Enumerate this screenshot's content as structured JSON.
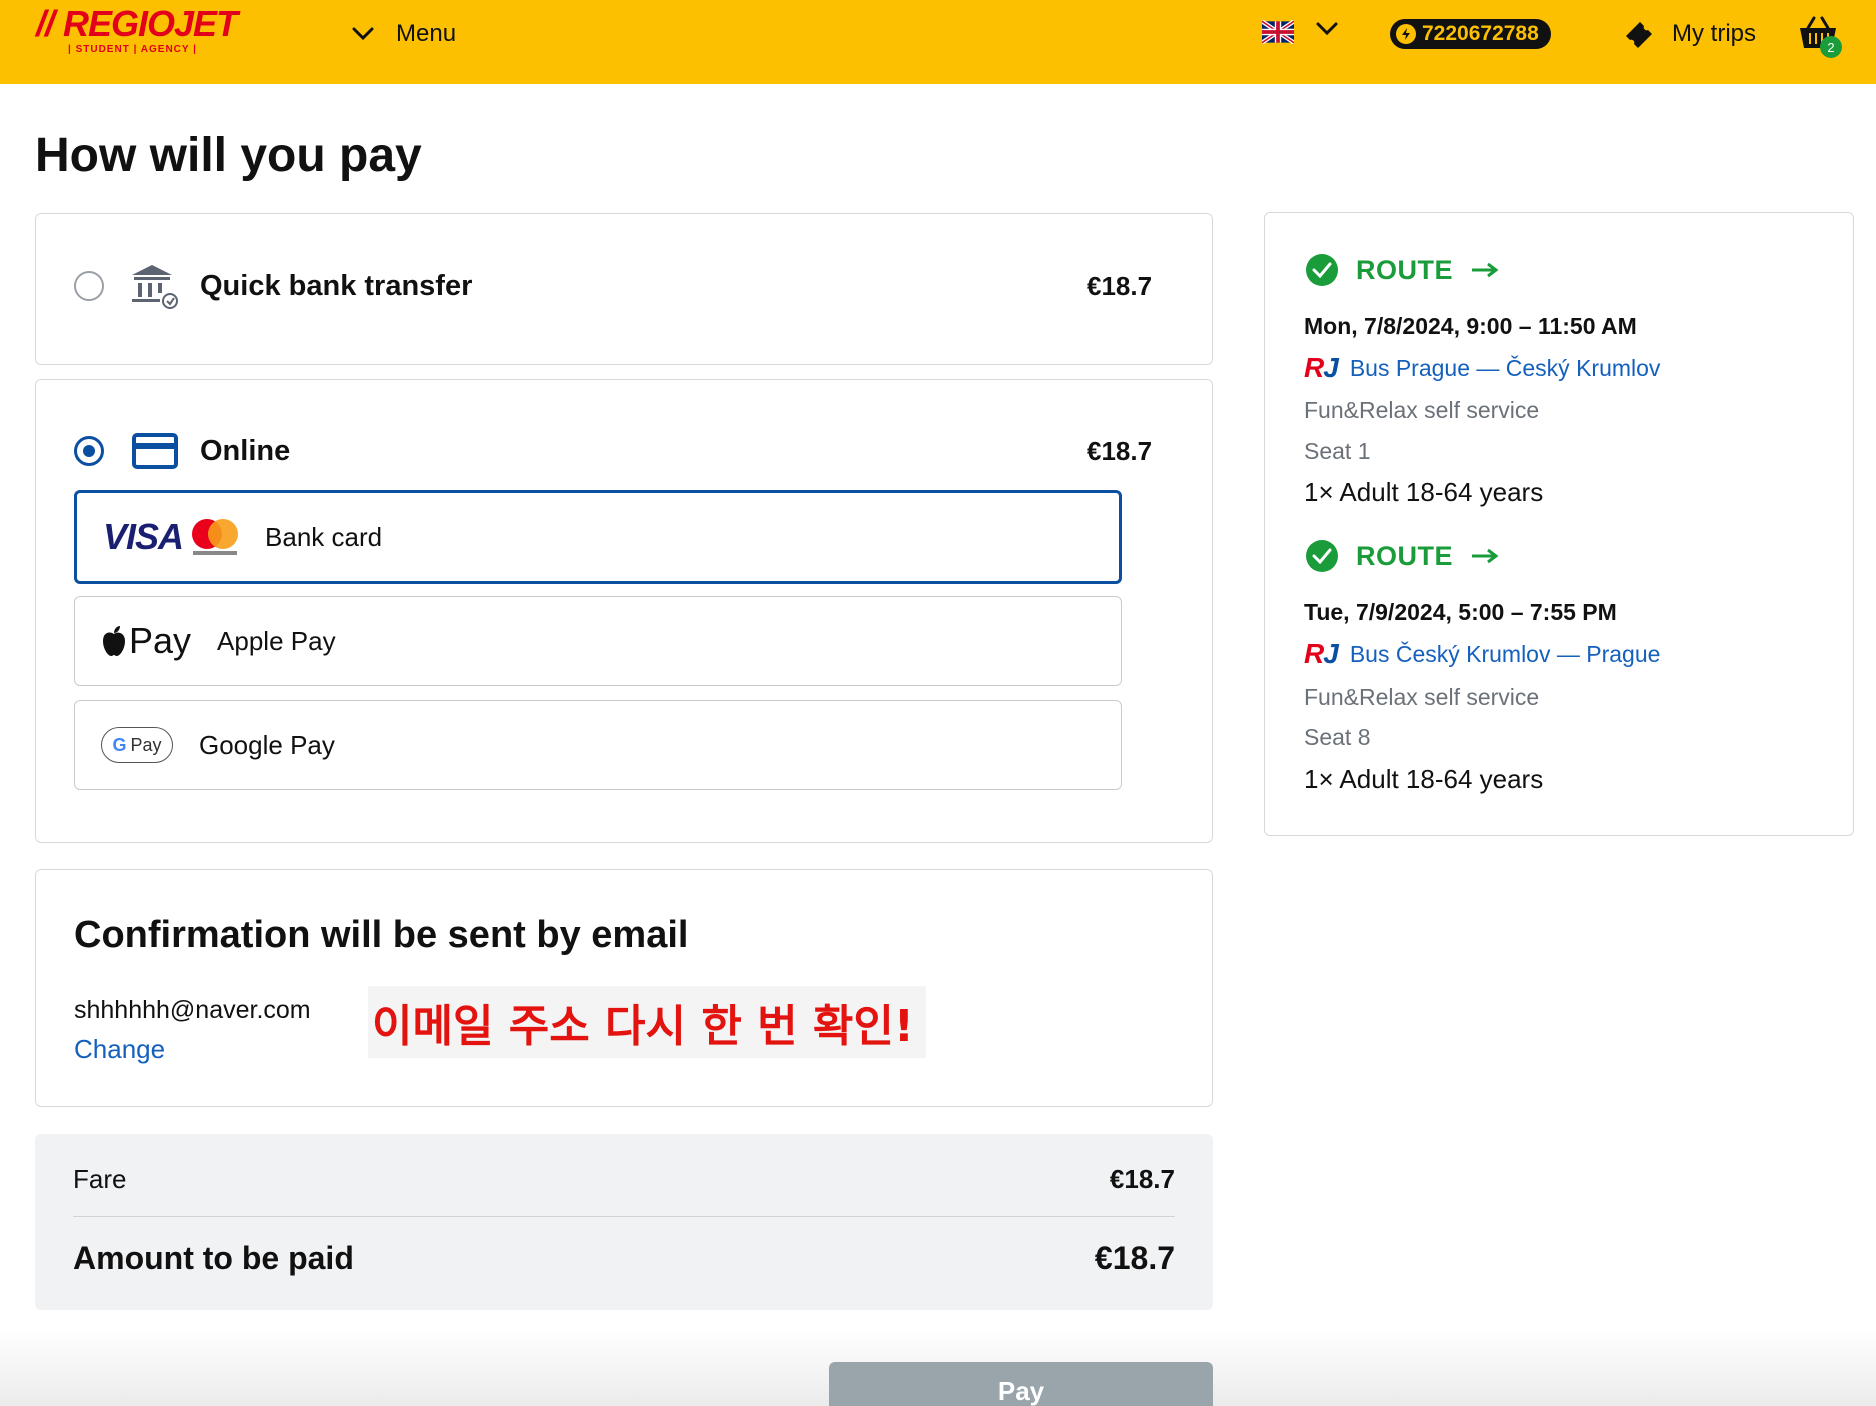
{
  "header": {
    "logo_text": "// REGIOJET",
    "logo_sub": "| STUDENT | AGENCY |",
    "menu_label": "Menu",
    "credit_amount": "7220672788",
    "my_trips_label": "My trips",
    "cart_count": "2",
    "accent_color": "#fcc000"
  },
  "page": {
    "title": "How will you pay"
  },
  "payment": {
    "quick_bank": {
      "label": "Quick bank transfer",
      "price": "€18.7",
      "selected": false
    },
    "online": {
      "label": "Online",
      "price": "€18.7",
      "selected": true
    },
    "methods": [
      {
        "label": "Bank card",
        "logo": "VISA",
        "selected": true
      },
      {
        "label": "Apple Pay",
        "logo": "Pay",
        "selected": false
      },
      {
        "label": "Google Pay",
        "logo": "G Pay",
        "selected": false
      }
    ]
  },
  "confirmation": {
    "title": "Confirmation will be sent by email",
    "email": "shhhhhh@naver.com",
    "change_label": "Change",
    "annotation": "이메일 주소 다시 한 번 확인!"
  },
  "summary": {
    "fare_label": "Fare",
    "fare_value": "€18.7",
    "total_label": "Amount to be paid",
    "total_value": "€18.7"
  },
  "pay_button_label": "Pay",
  "routes": [
    {
      "label": "ROUTE",
      "date": "Mon, 7/8/2024, 9:00 – 11:50 AM",
      "name": "Bus Prague — Český Krumlov",
      "service": "Fun&Relax self service",
      "seat": "Seat 1",
      "passengers": "1× Adult 18-64 years"
    },
    {
      "label": "ROUTE",
      "date": "Tue, 7/9/2024, 5:00 – 7:55 PM",
      "name": "Bus Český Krumlov — Prague",
      "service": "Fun&Relax self service",
      "seat": "Seat 8",
      "passengers": "1× Adult 18-64 years"
    }
  ]
}
